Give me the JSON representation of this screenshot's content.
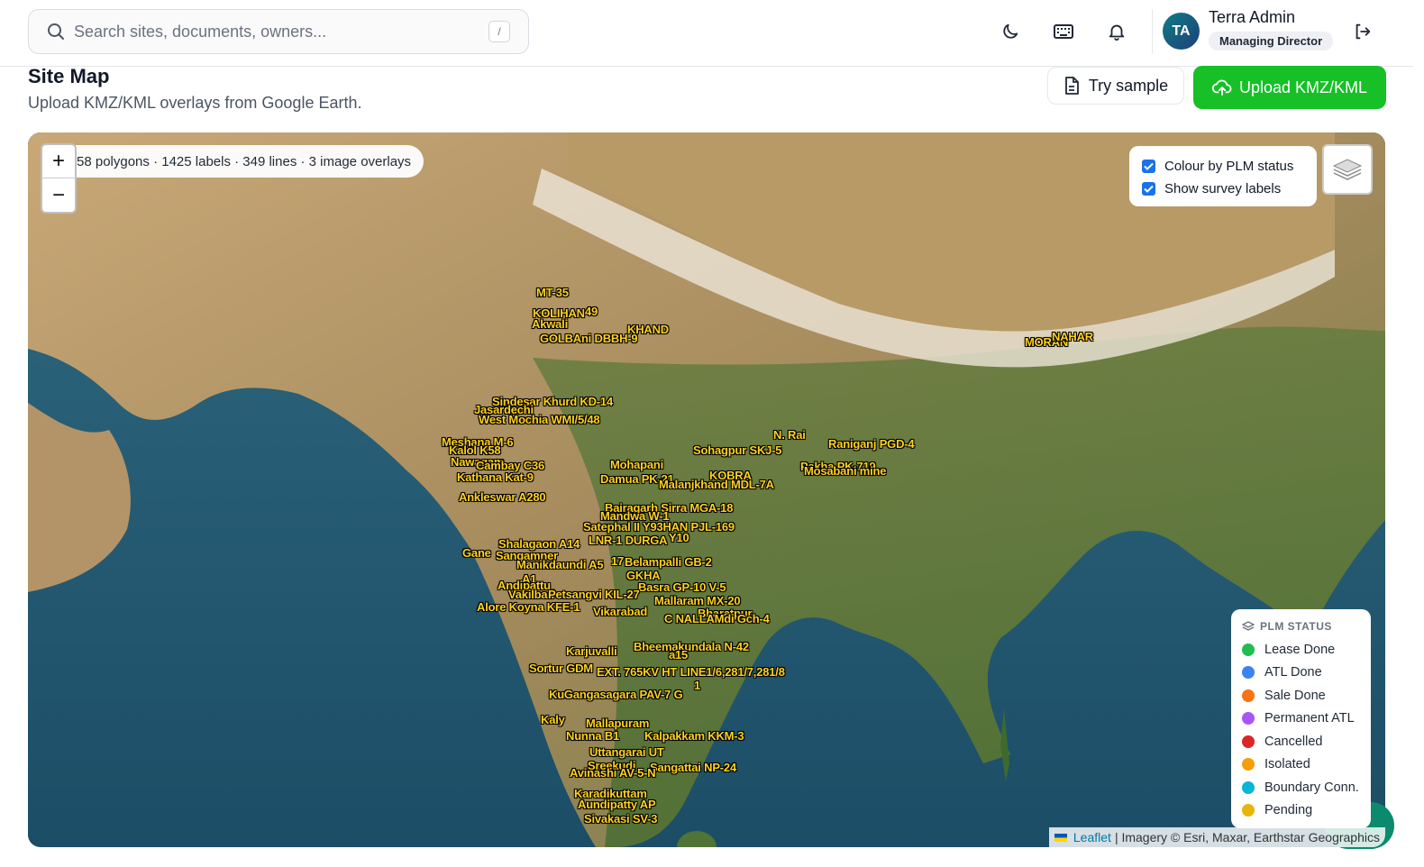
{
  "header": {
    "search_placeholder": "Search sites, documents, owners...",
    "search_shortcut": "/",
    "icons": [
      "moon-icon",
      "keyboard-icon",
      "bell-icon",
      "logout-icon"
    ],
    "user": {
      "initials": "TA",
      "name": "Terra Admin",
      "role": "Managing Director"
    }
  },
  "page": {
    "title": "Site Map",
    "subtitle": "Upload KMZ/KML overlays from Google Earth.",
    "try_sample_label": "Try sample",
    "upload_label": "Upload KMZ/KML"
  },
  "map": {
    "stats": "58 polygons · 1425 labels · 349 lines · 3 image overlays",
    "zoom_in": "+",
    "zoom_out": "−",
    "options": {
      "colour_by_status": "Colour by PLM status",
      "show_labels": "Show survey labels"
    },
    "legend": {
      "title": "PLM STATUS",
      "items": [
        {
          "label": "Lease Done",
          "color": "#1fbf4f"
        },
        {
          "label": "ATL Done",
          "color": "#3b82f6"
        },
        {
          "label": "Sale Done",
          "color": "#f97316"
        },
        {
          "label": "Permanent ATL",
          "color": "#a855f7"
        },
        {
          "label": "Cancelled",
          "color": "#dc2626"
        },
        {
          "label": "Isolated",
          "color": "#f59e0b"
        },
        {
          "label": "Boundary Conn.",
          "color": "#06b6d4"
        },
        {
          "label": "Pending",
          "color": "#eab308"
        }
      ]
    },
    "attribution": {
      "leaflet": "Leaflet",
      "imagery": "| Imagery © Esri, Maxar, Earthstar Geographics"
    },
    "labels": [
      "MT-35",
      "KOLIHAN",
      "49",
      "Akwali",
      "KHAND",
      "GOLBAni DBBH-9",
      "MORAN",
      "NAHAR",
      "Sindesar Khurd KD-14",
      "Jasardechi",
      "West Mochia WMI/5/48",
      "Meshana M-6",
      "Kalol K58",
      "Nawagam",
      "Cambay C36",
      "Kathana Kat-9",
      "Ankleswar A280",
      "Mohapani",
      "Damua PK-21",
      "Sohagpur SKJ-5",
      "KOBRA",
      "Malanjkhand MDL-7A",
      "N. Rai",
      "Raniganj PGD-4",
      "Pakha PK-719",
      "Mosabani mine",
      "Bairagarh Sirra MGA-18",
      "Mandwa W-1",
      "Satephal II Y93HAN PJL-169",
      "LNR-1 DURGA",
      "Y10",
      "Shalagaon A14",
      "Gane",
      "Sangamner",
      "Manikdaundi A5",
      "17",
      "Belampalli GB-2",
      "GKHA",
      "A1",
      "Andipattu",
      "Basra GP-10 V-5",
      "Vakilbad",
      "Petsangvi KIL-27",
      "Mallaram MX-20",
      "Alore Koyna KFE-1",
      "Vikarabad",
      "Bharatpur",
      "C NALLAMdi Gch-4",
      "Karjuvalli",
      "Bheemakundala N-42",
      "a15",
      "Sortur GDM",
      "EXT. 765KV HT LINE1/6,281/7,281/8",
      "KuGangasagara PAV-7 G",
      "1",
      "Kaly",
      "Mallapuram",
      "Nunna B1",
      "Kalpakkam KKM-3",
      "Uttangarai UT",
      "Sreekudi",
      "Sangattai NP-24",
      "Avinashi AV-5-N",
      "Karadikuttam",
      "Aundipatty AP",
      "Sivakasi SV-3"
    ]
  }
}
